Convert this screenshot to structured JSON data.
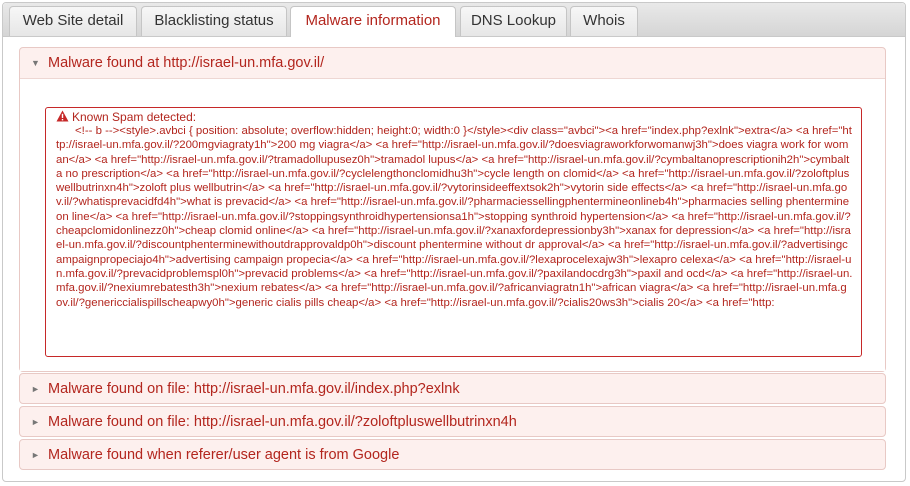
{
  "tabs": [
    {
      "label": "Web Site detail"
    },
    {
      "label": "Blacklisting status"
    },
    {
      "label": "Malware information"
    },
    {
      "label": "DNS Lookup"
    },
    {
      "label": "Whois"
    }
  ],
  "active_tab": "Malware information",
  "panels": [
    {
      "title": "Malware found at http://israel-un.mfa.gov.il/",
      "expanded": true
    },
    {
      "title": "Malware found on file: http://israel-un.mfa.gov.il/index.php?exlnk",
      "expanded": false
    },
    {
      "title": "Malware found on file: http://israel-un.mfa.gov.il/?zoloftpluswellbutrinxn4h",
      "expanded": false
    },
    {
      "title": "Malware found when referer/user agent is from Google",
      "expanded": false
    }
  ],
  "alert": {
    "title": "Known Spam detected:",
    "content": "      <!-- b --><style>.avbci { position: absolute; overflow:hidden; height:0; width:0 }</style><div class=\"avbci\"><a href=\"index.php?exlnk\">extra</a> <a href=\"http://israel-un.mfa.gov.il/?200mgviagraty1h\">200 mg viagra</a> <a href=\"http://israel-un.mfa.gov.il/?doesviagraworkforwomanwj3h\">does viagra work for woman</a> <a href=\"http://israel-un.mfa.gov.il/?tramadollupusez0h\">tramadol lupus</a> <a href=\"http://israel-un.mfa.gov.il/?cymbaltanoprescriptionih2h\">cymbalta no prescription</a> <a href=\"http://israel-un.mfa.gov.il/?cyclelengthonclomidhu3h\">cycle length on clomid</a> <a href=\"http://israel-un.mfa.gov.il/?zoloftpluswellbutrinxn4h\">zoloft plus wellbutrin</a> <a href=\"http://israel-un.mfa.gov.il/?vytorinsideeffextsok2h\">vytorin side effects</a> <a href=\"http://israel-un.mfa.gov.il/?whatisprevacidfd4h\">what is prevacid</a> <a href=\"http://israel-un.mfa.gov.il/?pharmaciessellingphentermineonlineb4h\">pharmacies selling phentermine on line</a> <a href=\"http://israel-un.mfa.gov.il/?stoppingsynthroidhypertensionsa1h\">stopping synthroid hypertension</a> <a href=\"http://israel-un.mfa.gov.il/?cheapclomidonlinezz0h\">cheap clomid online</a> <a href=\"http://israel-un.mfa.gov.il/?xanaxfordepressionby3h\">xanax for depression</a> <a href=\"http://israel-un.mfa.gov.il/?discountphenterminewithoutdrapprovaldp0h\">discount phentermine without dr approval</a> <a href=\"http://israel-un.mfa.gov.il/?advertisingcampaignpropeciajo4h\">advertising campaign propecia</a> <a href=\"http://israel-un.mfa.gov.il/?lexaprocelexajw3h\">lexapro celexa</a> <a href=\"http://israel-un.mfa.gov.il/?prevacidproblemspl0h\">prevacid problems</a> <a href=\"http://israel-un.mfa.gov.il/?paxilandocdrg3h\">paxil and ocd</a> <a href=\"http://israel-un.mfa.gov.il/?nexiumrebatesth3h\">nexium rebates</a> <a href=\"http://israel-un.mfa.gov.il/?africanviagratn1h\">african viagra</a> <a href=\"http://israel-un.mfa.gov.il/?genericcialispillscheapwy0h\">generic cialis pills cheap</a> <a href=\"http://israel-un.mfa.gov.il/?cialis20ws3h\">cialis 20</a> <a href=\"http:"
  },
  "colors": {
    "accent_red": "#b3261e",
    "panel_bg": "#fdf0ee",
    "border_red": "#c62828"
  }
}
